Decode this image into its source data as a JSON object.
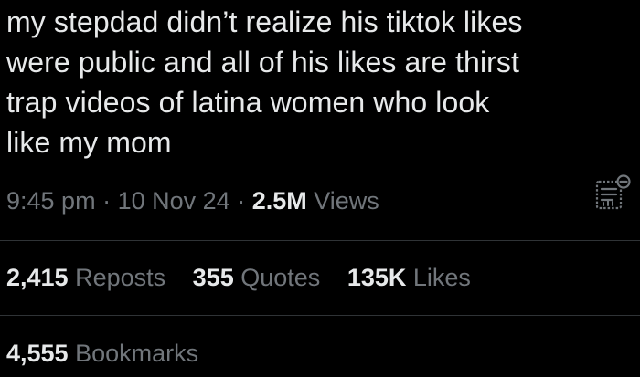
{
  "tweet": {
    "text": "my stepdad didn’t realize his tiktok likes\nwere public and all of his likes are thirst\ntrap videos of latina women who look\nlike my mom"
  },
  "meta": {
    "time": "9:45 pm",
    "separator1": "·",
    "date": "10 Nov 24",
    "separator2": "·",
    "views_count": "2.5M",
    "views_label": "Views"
  },
  "stats": {
    "reposts_count": "2,415",
    "reposts_label": "Reposts",
    "quotes_count": "355",
    "quotes_label": "Quotes",
    "likes_count": "135K",
    "likes_label": "Likes",
    "bookmarks_count": "4,555",
    "bookmarks_label": "Bookmarks"
  },
  "icons": {
    "analytics": "analytics-icon"
  },
  "colors": {
    "background": "#000000",
    "primary_text": "#e7e9ea",
    "secondary_text": "#71767b",
    "divider": "#2f3336"
  }
}
